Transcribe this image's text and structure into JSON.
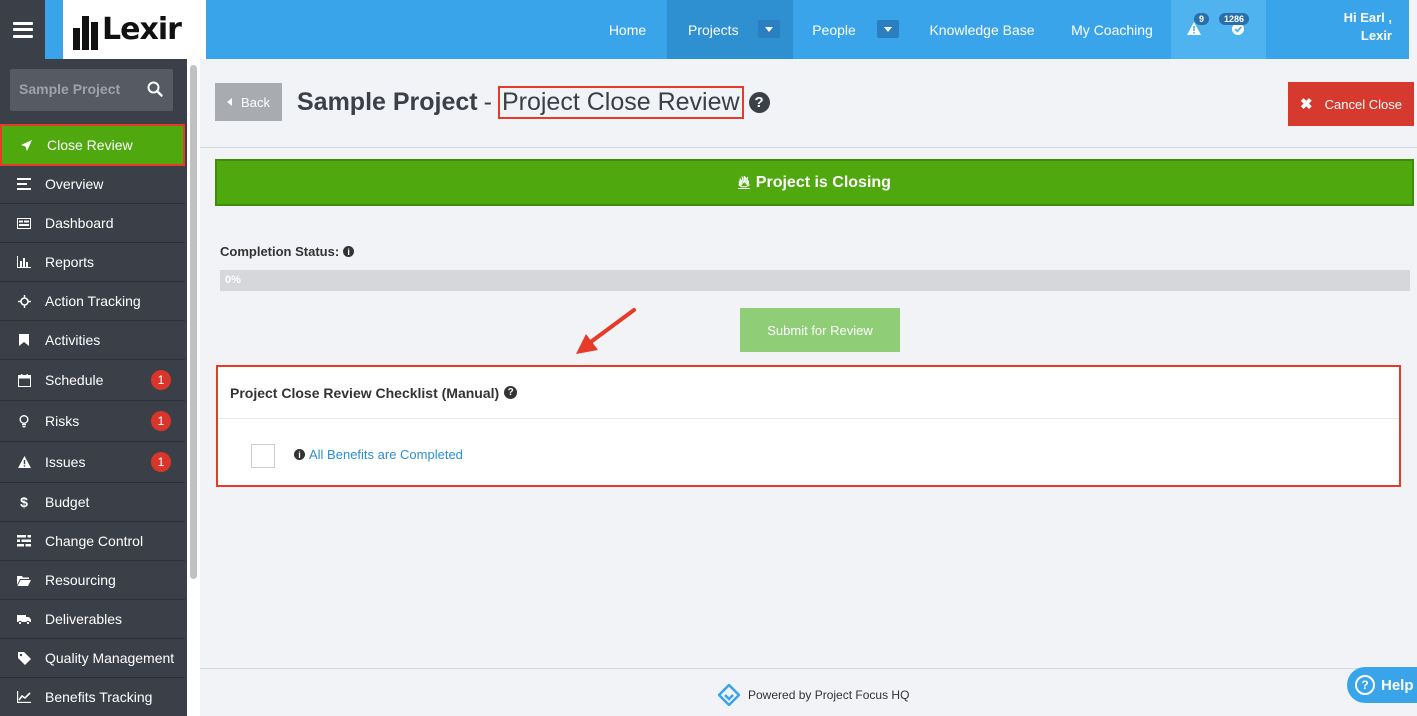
{
  "topbar": {
    "logo_text": "Lexir",
    "nav": [
      {
        "label": "Home"
      },
      {
        "label": "Projects"
      },
      {
        "label": "People"
      },
      {
        "label": "Knowledge Base"
      },
      {
        "label": "My Coaching"
      }
    ],
    "alerts_count": "9",
    "notifications_count": "1286",
    "greeting_line1": "Hi Earl ,",
    "greeting_line2": "Lexir"
  },
  "sidebar": {
    "search_placeholder": "Sample Project",
    "items": [
      {
        "label": "Close Review",
        "icon": "rocket-icon"
      },
      {
        "label": "Overview",
        "icon": "list-icon"
      },
      {
        "label": "Dashboard",
        "icon": "dashboard-icon"
      },
      {
        "label": "Reports",
        "icon": "bar-chart-icon"
      },
      {
        "label": "Action Tracking",
        "icon": "crosshair-icon"
      },
      {
        "label": "Activities",
        "icon": "bookmark-icon"
      },
      {
        "label": "Schedule",
        "icon": "calendar-icon",
        "badge": "1"
      },
      {
        "label": "Risks",
        "icon": "lightbulb-icon",
        "badge": "1"
      },
      {
        "label": "Issues",
        "icon": "warning-icon",
        "badge": "1"
      },
      {
        "label": "Budget",
        "icon": "dollar-icon"
      },
      {
        "label": "Change Control",
        "icon": "sliders-icon"
      },
      {
        "label": "Resourcing",
        "icon": "folder-icon"
      },
      {
        "label": "Deliverables",
        "icon": "truck-icon"
      },
      {
        "label": "Quality Management",
        "icon": "tag-icon"
      },
      {
        "label": "Benefits Tracking",
        "icon": "line-chart-icon"
      }
    ]
  },
  "main": {
    "back_label": "Back",
    "title_project": "Sample Project",
    "title_dash": "-",
    "title_sub": "Project Close Review",
    "cancel_label": "Cancel Close",
    "banner_label": "Project is Closing",
    "completion_label": "Completion Status:",
    "progress_value": 0,
    "progress_text": "0%",
    "submit_label": "Submit for Review",
    "checklist_title": "Project Close Review Checklist (Manual)",
    "checklist_items": [
      {
        "label": "All Benefits are Completed",
        "checked": false
      }
    ]
  },
  "footer": {
    "powered_by": "Powered by Project Focus HQ",
    "help_label": "Help"
  },
  "colors": {
    "topbar": "#3aa4eb",
    "sidebar": "#3b3f48",
    "accent_green": "#4ea80e",
    "danger": "#d63a2f",
    "highlight": "#e63b28"
  }
}
